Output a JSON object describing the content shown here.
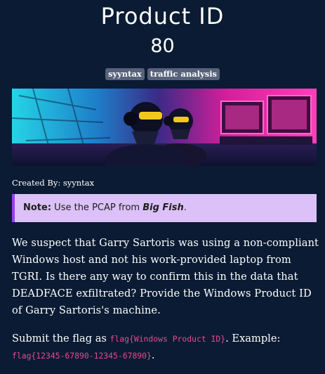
{
  "challenge": {
    "title": "Product ID",
    "points": "80",
    "tags": [
      "syyntax",
      "traffic analysis"
    ]
  },
  "banner": {
    "description": ""
  },
  "created_by": "Created By: syyntax",
  "note": {
    "label": "Note:",
    "text_before": " Use the PCAP from ",
    "reference": "Big Fish",
    "text_after": "."
  },
  "description": "We suspect that Garry Sartoris was using a non-compliant Windows host and not his work-provided laptop from TGRI. Is there any way to confirm this in the data that DEADFACE exfiltrated? Provide the Windows Product ID of Garry Sartoris's machine.",
  "submit": {
    "prefix": "Submit the flag as ",
    "flag_format": "flag{Windows Product ID}",
    "example_label": ". Example:",
    "example_flag": "flag{12345-67890-12345-67890}",
    "suffix": "."
  },
  "colors": {
    "background": "#0a1b33",
    "tag_bg": "#57627a",
    "note_bg": "#dbc1f7",
    "note_border": "#9640e8",
    "code_pink": "#e34b8f",
    "banner_cyan": "#21cfe0",
    "banner_magenta": "#ff2fae"
  }
}
